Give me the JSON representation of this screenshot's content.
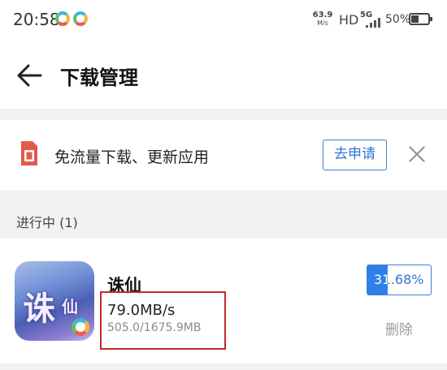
{
  "status_bar": {
    "time": "20:58",
    "net_speed_value": "63.9",
    "net_speed_unit": "M/s",
    "hd": "HD",
    "network": "5G",
    "battery_percent": "50%",
    "battery_level": 0.5,
    "app_icon": "colorful-ring-icon"
  },
  "header": {
    "back_icon": "arrow-left-icon",
    "title": "下载管理"
  },
  "banner": {
    "icon": "sim-card-icon",
    "text": "免流量下载、更新应用",
    "apply_label": "去申请",
    "close_icon": "close-icon",
    "accent": "#2f74d4"
  },
  "section": {
    "title": "进行中 (1)"
  },
  "downloads": [
    {
      "name": "诛仙",
      "icon": "app-icon-zhuxian",
      "icon_glyphs": [
        "诛",
        "仙"
      ],
      "speed": "79.0MB/s",
      "size": "505.0/1675.9MB",
      "progress_label": "31.68%",
      "progress": 0.3168,
      "delete_label": "删除"
    }
  ],
  "colors": {
    "highlight_box": "#c62828",
    "progress_fill": "#2f80e8",
    "background_gray": "#f2f2f2"
  }
}
